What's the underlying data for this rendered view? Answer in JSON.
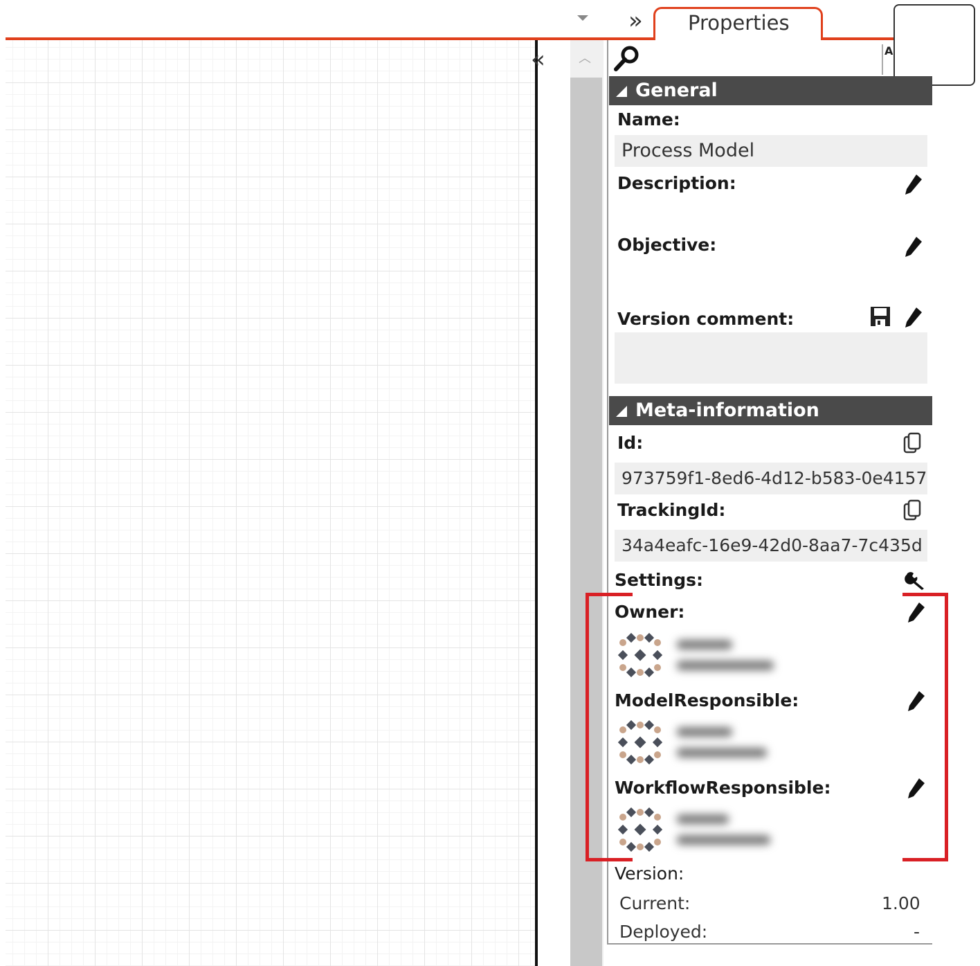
{
  "tab": {
    "label": "Properties"
  },
  "toolbar": {
    "expand_glyph": "»",
    "collapse_glyph": "«",
    "sort_glyph": "AZ"
  },
  "general": {
    "header": "General",
    "name_label": "Name:",
    "name_value": "Process Model",
    "description_label": "Description:",
    "objective_label": "Objective:",
    "version_comment_label": "Version comment:"
  },
  "meta": {
    "header": "Meta-information",
    "id_label": "Id:",
    "id_value": "973759f1-8ed6-4d12-b583-0e4157",
    "tracking_label": "TrackingId:",
    "tracking_value": "34a4eafc-16e9-42d0-8aa7-7c435d",
    "settings_label": "Settings:",
    "owner_label": "Owner:",
    "model_responsible_label": "ModelResponsible:",
    "workflow_responsible_label": "WorkflowResponsible:",
    "version_label": "Version:",
    "current_label": "Current:",
    "current_value": "1.00",
    "deployed_label": "Deployed:",
    "deployed_value": "-"
  },
  "colors": {
    "accent": "#e0401c",
    "highlight": "#d92025",
    "header_bg": "#4a4a4a",
    "field_bg": "#efefef"
  },
  "icons": [
    "search-icon",
    "pencil-icon",
    "save-icon",
    "copy-icon",
    "wrench-icon",
    "avatar-icon",
    "sort-az-icon"
  ]
}
